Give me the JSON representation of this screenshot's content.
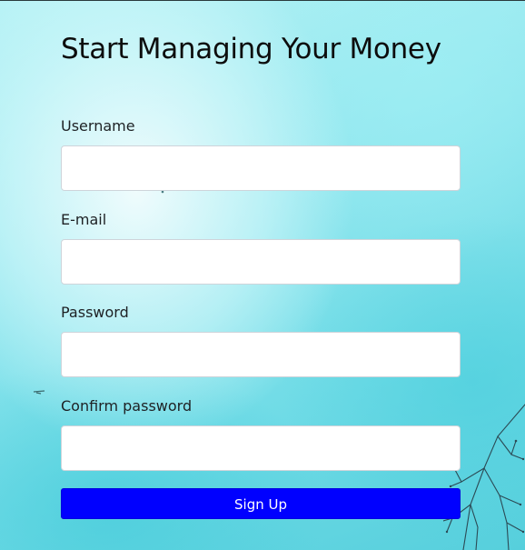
{
  "form": {
    "title": "Start Managing Your Money",
    "fields": [
      {
        "label": "Username",
        "value": ""
      },
      {
        "label": "E-mail",
        "value": ""
      },
      {
        "label": "Password",
        "value": ""
      },
      {
        "label": "Confirm password",
        "value": ""
      }
    ],
    "submit_label": "Sign Up"
  },
  "colors": {
    "button": "#0000ff",
    "background": "#8fe6ee"
  }
}
